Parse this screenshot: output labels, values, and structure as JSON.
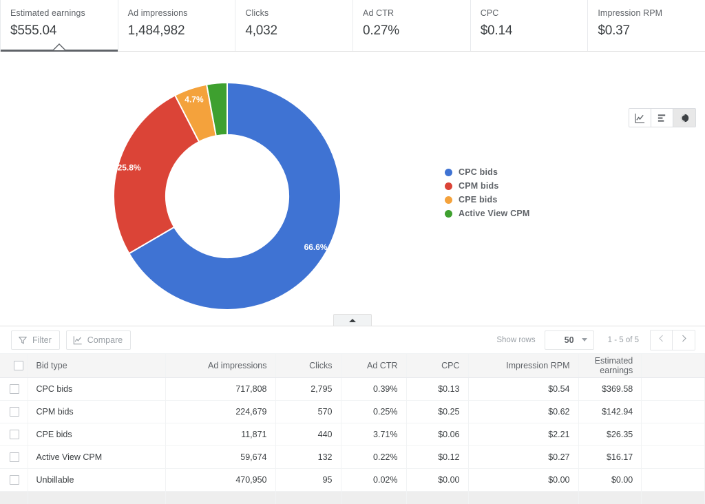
{
  "metrics": [
    {
      "label": "Estimated earnings",
      "value": "$555.04",
      "selected": true
    },
    {
      "label": "Ad impressions",
      "value": "1,484,982",
      "selected": false
    },
    {
      "label": "Clicks",
      "value": "4,032",
      "selected": false
    },
    {
      "label": "Ad CTR",
      "value": "0.27%",
      "selected": false
    },
    {
      "label": "CPC",
      "value": "$0.14",
      "selected": false
    },
    {
      "label": "Impression RPM",
      "value": "$0.37",
      "selected": false
    }
  ],
  "chart_toolbar": {
    "line_icon": "line-chart-icon",
    "bar_icon": "bar-chart-icon",
    "pie_icon": "pie-chart-icon",
    "active": "pie"
  },
  "chart_data": {
    "type": "pie",
    "variant": "donut",
    "title": "",
    "categories": [
      "CPC bids",
      "CPM bids",
      "CPE bids",
      "Active View CPM"
    ],
    "values": [
      66.6,
      25.8,
      4.7,
      2.9
    ],
    "value_labels": [
      "66.6%",
      "25.8%",
      "4.7%",
      ""
    ],
    "colors": [
      "#3f73d3",
      "#db4437",
      "#f4a23c",
      "#3ea02f"
    ],
    "legend_position": "right",
    "legend": [
      "CPC bids",
      "CPM bids",
      "CPE bids",
      "Active View CPM"
    ],
    "metric": "Estimated earnings",
    "start_angle": 0,
    "inner_radius_ratio": 0.54
  },
  "collapse": {
    "icon": "chevron-up-icon"
  },
  "table_toolbar": {
    "filter_label": "Filter",
    "filter_icon": "funnel-icon",
    "compare_label": "Compare",
    "compare_icon": "line-chart-icon",
    "show_rows_label": "Show rows",
    "rows_value": "50",
    "rows_caret_icon": "chevron-down-icon",
    "range_text": "1 - 5 of 5",
    "prev_icon": "chevron-left-icon",
    "next_icon": "chevron-right-icon"
  },
  "table": {
    "columns": [
      {
        "label": "Bid type",
        "align": "txt"
      },
      {
        "label": "Ad impressions",
        "align": "num"
      },
      {
        "label": "Clicks",
        "align": "num"
      },
      {
        "label": "Ad CTR",
        "align": "num"
      },
      {
        "label": "CPC",
        "align": "num"
      },
      {
        "label": "Impression RPM",
        "align": "num"
      },
      {
        "label": "Estimated earnings",
        "align": "num"
      }
    ],
    "rows": [
      {
        "cells": [
          "CPC bids",
          "717,808",
          "2,795",
          "0.39%",
          "$0.13",
          "$0.54",
          "$369.58"
        ]
      },
      {
        "cells": [
          "CPM bids",
          "224,679",
          "570",
          "0.25%",
          "$0.25",
          "$0.62",
          "$142.94"
        ]
      },
      {
        "cells": [
          "CPE bids",
          "11,871",
          "440",
          "3.71%",
          "$0.06",
          "$2.21",
          "$26.35"
        ]
      },
      {
        "cells": [
          "Active View CPM",
          "59,674",
          "132",
          "0.22%",
          "$0.12",
          "$0.27",
          "$16.17"
        ]
      },
      {
        "cells": [
          "Unbillable",
          "470,950",
          "95",
          "0.02%",
          "$0.00",
          "$0.00",
          "$0.00"
        ]
      }
    ],
    "totals": {
      "cells": [
        "",
        "",
        "",
        "",
        "",
        "",
        ""
      ]
    }
  },
  "colors": {
    "blue": "#3f73d3",
    "red": "#db4437",
    "orange": "#f4a23c",
    "green": "#3ea02f",
    "text": "#3c4043",
    "muted": "#5f6368"
  }
}
